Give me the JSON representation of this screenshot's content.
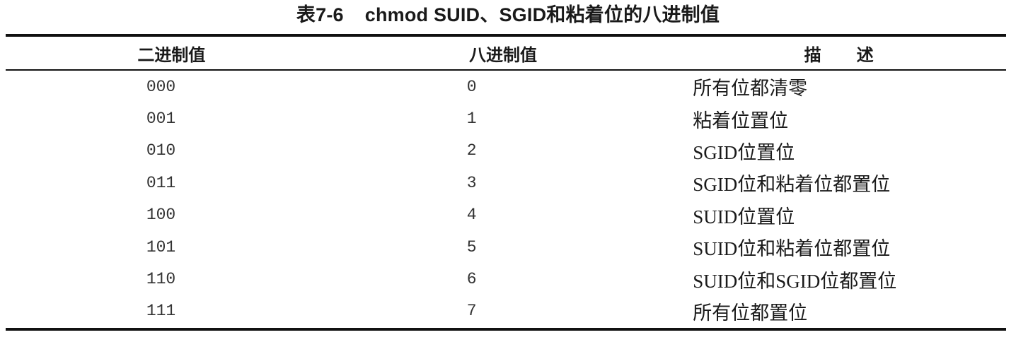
{
  "caption": {
    "number": "表7-6",
    "title": "chmod SUID、SGID和粘着位的八进制值"
  },
  "table": {
    "headers": [
      "二进制值",
      "八进制值",
      "描述"
    ],
    "rows": [
      {
        "binary": "000",
        "octal": "0",
        "desc": "所有位都清零"
      },
      {
        "binary": "001",
        "octal": "1",
        "desc": "粘着位置位"
      },
      {
        "binary": "010",
        "octal": "2",
        "desc": "SGID位置位"
      },
      {
        "binary": "011",
        "octal": "3",
        "desc": "SGID位和粘着位都置位"
      },
      {
        "binary": "100",
        "octal": "4",
        "desc": "SUID位置位"
      },
      {
        "binary": "101",
        "octal": "5",
        "desc": "SUID位和粘着位都置位"
      },
      {
        "binary": "110",
        "octal": "6",
        "desc": "SUID位和SGID位都置位"
      },
      {
        "binary": "111",
        "octal": "7",
        "desc": "所有位都置位"
      }
    ]
  }
}
